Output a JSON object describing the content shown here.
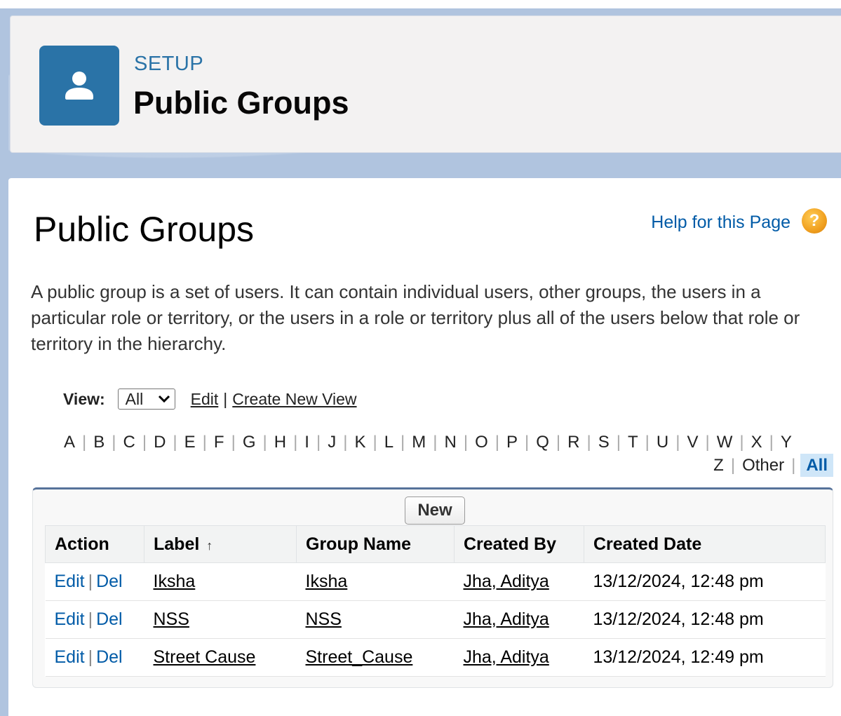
{
  "header": {
    "eyebrow": "SETUP",
    "title": "Public Groups",
    "icon": "user-icon"
  },
  "page": {
    "title": "Public Groups",
    "help_link": "Help for this Page",
    "help_icon": "question-icon",
    "description": "A public group is a set of users. It can contain individual users, other groups, the users in a particular role or territory, or the users in a role or territory plus all of the users below that role or territory in the hierarchy."
  },
  "view": {
    "label": "View:",
    "selected": "All",
    "edit_link": "Edit",
    "create_link": "Create New View"
  },
  "alphabet": {
    "row1": [
      "A",
      "B",
      "C",
      "D",
      "E",
      "F",
      "G",
      "H",
      "I",
      "J",
      "K",
      "L",
      "M",
      "N",
      "O",
      "P",
      "Q",
      "R",
      "S",
      "T",
      "U",
      "V",
      "W",
      "X",
      "Y"
    ],
    "row2": [
      "Z",
      "Other",
      "All"
    ],
    "active": "All"
  },
  "list": {
    "new_button": "New",
    "columns": [
      "Action",
      "Label",
      "Group Name",
      "Created By",
      "Created Date"
    ],
    "sort_indicator": "↑",
    "rows": [
      {
        "edit": "Edit",
        "del": "Del",
        "label": "Iksha",
        "group_name": "Iksha",
        "created_by": "Jha, Aditya",
        "created_date": "13/12/2024, 12:48 pm"
      },
      {
        "edit": "Edit",
        "del": "Del",
        "label": "NSS",
        "group_name": "NSS",
        "created_by": "Jha, Aditya",
        "created_date": "13/12/2024, 12:48 pm"
      },
      {
        "edit": "Edit",
        "del": "Del",
        "label": "Street Cause",
        "group_name": "Street_Cause",
        "created_by": "Jha, Aditya",
        "created_date": "13/12/2024, 12:49 pm"
      }
    ]
  },
  "colors": {
    "brand_blue": "#2a73a7",
    "link_blue": "#015ba7",
    "backdrop": "#b0c4df",
    "help_orange": "#f0a020"
  }
}
